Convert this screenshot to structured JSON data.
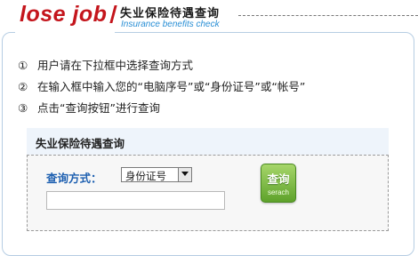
{
  "header": {
    "brand": "lose job",
    "title_cn": "失业保险待遇查询",
    "title_en": "Insurance benefits check"
  },
  "steps": [
    {
      "num": "①",
      "text": "用户请在下拉框中选择查询方式"
    },
    {
      "num": "②",
      "text": "在输入框中输入您的“电脑序号”或“身份证号”或“帐号”"
    },
    {
      "num": "③",
      "text": "点击“查询按钮”进行查询"
    }
  ],
  "panel": {
    "title": "失业保险待遇查询",
    "query_label": "查询方式：",
    "select_value": "身份证号",
    "input_value": "",
    "button_cn": "查询",
    "button_en": "serach"
  },
  "colors": {
    "brand_red": "#c4151c",
    "link_blue": "#2a8fd5",
    "label_blue": "#1d5fb0",
    "button_green": "#6ab034"
  }
}
